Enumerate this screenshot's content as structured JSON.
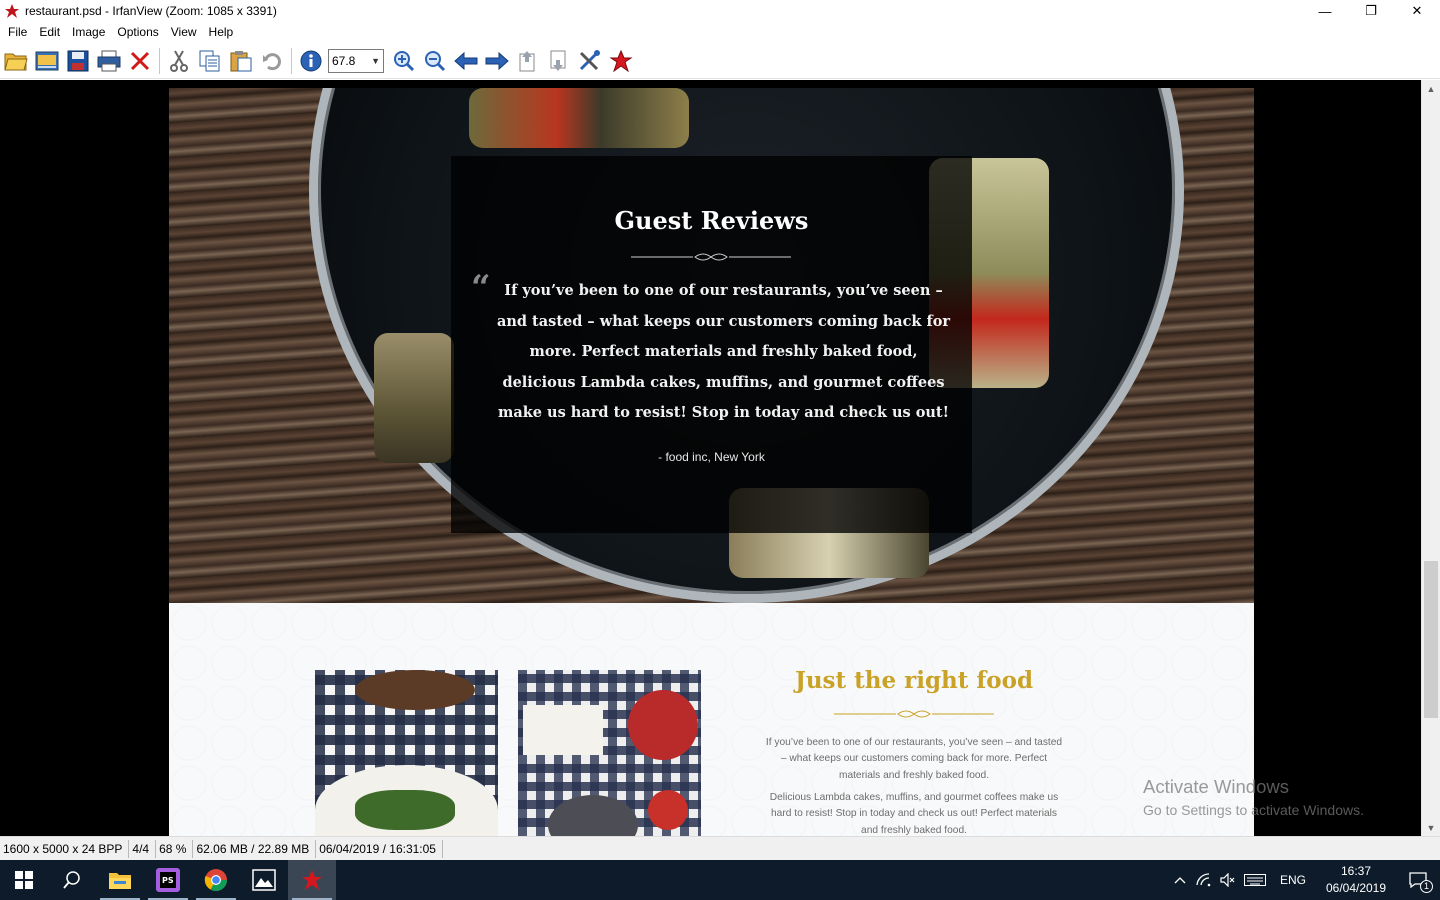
{
  "window": {
    "title": "restaurant.psd - IrfanView (Zoom: 1085 x 3391)",
    "minimize": "—",
    "restore": "❐",
    "close": "✕"
  },
  "menu": [
    "File",
    "Edit",
    "Image",
    "Options",
    "View",
    "Help"
  ],
  "toolbar": {
    "buttons": [
      "open-icon",
      "thumbnails-icon",
      "save-icon",
      "print-icon",
      "delete-icon",
      "cut-icon",
      "copy-icon",
      "paste-icon",
      "undo-icon",
      "info-icon",
      "zoom-in-icon",
      "zoom-out-icon",
      "previous-icon",
      "next-icon",
      "page-up-icon",
      "page-down-icon",
      "settings-icon",
      "irfanview-icon"
    ],
    "zoom_value": "67.8"
  },
  "image": {
    "review": {
      "title": "Guest Reviews",
      "quote_mark": "“",
      "text": "If you’ve been to one of our restaurants, you’ve seen – and tasted – what keeps our customers coming back for more. Perfect materials and freshly baked food, delicious Lambda cakes,  muffins, and gourmet coffees make us hard to resist! Stop in today and check us out!",
      "author": "- food inc, New York"
    },
    "food": {
      "title": "Just the right food",
      "paragraph1": "If you’ve been to one of our restaurants, you’ve seen – and tasted – what keeps our customers coming back for more. Perfect materials and freshly baked food.",
      "paragraph2": "Delicious Lambda cakes,  muffins, and gourmet coffees make us hard to resist! Stop in today and check us out! Perfect materials and freshly baked food."
    },
    "colors": {
      "gold": "#c9a227",
      "overlay": "#000000",
      "text_gray": "#6d6d6d"
    }
  },
  "watermark": {
    "line1": "Activate Windows",
    "line2": "Go to Settings to activate Windows."
  },
  "status": [
    "1600 x 5000 x 24 BPP",
    "4/4",
    "68 %",
    "62.06 MB / 22.89 MB",
    "06/04/2019 / 16:31:05"
  ],
  "taskbar": {
    "apps": [
      "start-icon",
      "search-icon",
      "file-explorer-icon",
      "phpstorm-icon",
      "chrome-icon",
      "photos-icon",
      "irfanview-icon"
    ],
    "language": "ENG",
    "time": "16:37",
    "date": "06/04/2019",
    "notifications": "1"
  }
}
